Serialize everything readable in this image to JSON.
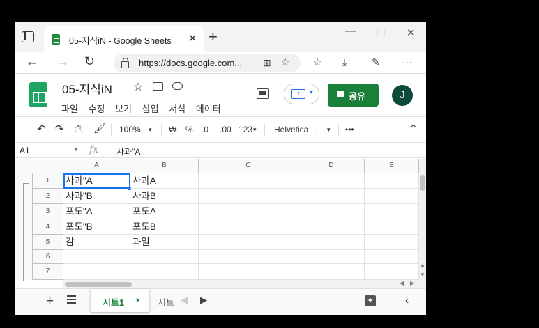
{
  "browser": {
    "tab_title": "05-지식iN - Google Sheets",
    "url": "https://docs.google.com..."
  },
  "app": {
    "doc_title": "05-지식iN",
    "menus": [
      "파일",
      "수정",
      "보기",
      "삽입",
      "서식",
      "데이터"
    ],
    "share_label": "공유",
    "avatar_initial": "J"
  },
  "toolbar": {
    "zoom": "100%",
    "currency": "₩",
    "percent": "%",
    "dec_decrease": ".0",
    "dec_increase": ".00",
    "format_more": "123",
    "font": "Helvetica ...",
    "more": "•••"
  },
  "formula_bar": {
    "name_box": "A1",
    "fx": "fx",
    "value": "사과\"A"
  },
  "grid": {
    "columns": [
      "A",
      "B",
      "C",
      "D",
      "E"
    ],
    "rows": [
      "1",
      "2",
      "3",
      "4",
      "5",
      "6",
      "7"
    ],
    "cells": [
      [
        "사과\"A",
        "사과A"
      ],
      [
        "사과\"B",
        "사과B"
      ],
      [
        "포도\"A",
        "포도A"
      ],
      [
        "포도\"B",
        "포도B"
      ],
      [
        "감",
        "과일"
      ],
      [
        "",
        ""
      ],
      [
        "",
        ""
      ]
    ],
    "selected": "A1"
  },
  "sheet_tabs": {
    "active": "시트1",
    "second": "시트"
  }
}
